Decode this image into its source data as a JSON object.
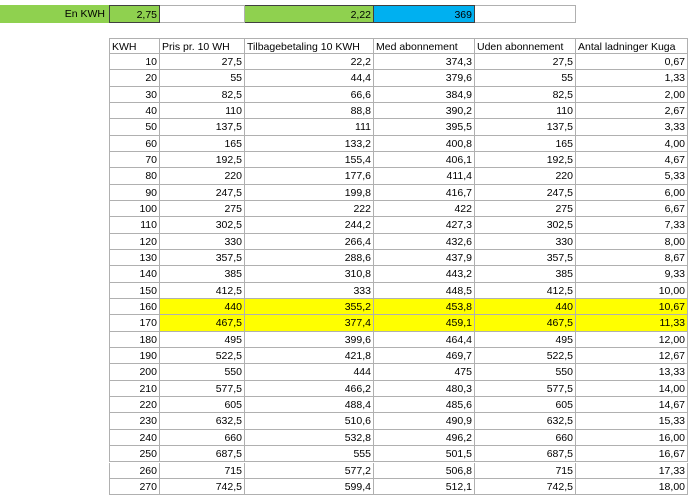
{
  "summary": {
    "label": "En KWH",
    "price": "2,75",
    "refund": "2,22",
    "subscription": "369"
  },
  "columns": [
    "KWH",
    "Pris pr. 10 WH",
    "Tilbagebetaling 10 KWH",
    "Med abonnement",
    "Uden abonnement",
    "Antal ladninger Kuga"
  ],
  "rows": [
    [
      "10",
      "27,5",
      "22,2",
      "374,3",
      "27,5",
      "0,67"
    ],
    [
      "20",
      "55",
      "44,4",
      "379,6",
      "55",
      "1,33"
    ],
    [
      "30",
      "82,5",
      "66,6",
      "384,9",
      "82,5",
      "2,00"
    ],
    [
      "40",
      "110",
      "88,8",
      "390,2",
      "110",
      "2,67"
    ],
    [
      "50",
      "137,5",
      "111",
      "395,5",
      "137,5",
      "3,33"
    ],
    [
      "60",
      "165",
      "133,2",
      "400,8",
      "165",
      "4,00"
    ],
    [
      "70",
      "192,5",
      "155,4",
      "406,1",
      "192,5",
      "4,67"
    ],
    [
      "80",
      "220",
      "177,6",
      "411,4",
      "220",
      "5,33"
    ],
    [
      "90",
      "247,5",
      "199,8",
      "416,7",
      "247,5",
      "6,00"
    ],
    [
      "100",
      "275",
      "222",
      "422",
      "275",
      "6,67"
    ],
    [
      "110",
      "302,5",
      "244,2",
      "427,3",
      "302,5",
      "7,33"
    ],
    [
      "120",
      "330",
      "266,4",
      "432,6",
      "330",
      "8,00"
    ],
    [
      "130",
      "357,5",
      "288,6",
      "437,9",
      "357,5",
      "8,67"
    ],
    [
      "140",
      "385",
      "310,8",
      "443,2",
      "385",
      "9,33"
    ],
    [
      "150",
      "412,5",
      "333",
      "448,5",
      "412,5",
      "10,00"
    ],
    [
      "160",
      "440",
      "355,2",
      "453,8",
      "440",
      "10,67"
    ],
    [
      "170",
      "467,5",
      "377,4",
      "459,1",
      "467,5",
      "11,33"
    ],
    [
      "180",
      "495",
      "399,6",
      "464,4",
      "495",
      "12,00"
    ],
    [
      "190",
      "522,5",
      "421,8",
      "469,7",
      "522,5",
      "12,67"
    ],
    [
      "200",
      "550",
      "444",
      "475",
      "550",
      "13,33"
    ],
    [
      "210",
      "577,5",
      "466,2",
      "480,3",
      "577,5",
      "14,00"
    ],
    [
      "220",
      "605",
      "488,4",
      "485,6",
      "605",
      "14,67"
    ],
    [
      "230",
      "632,5",
      "510,6",
      "490,9",
      "632,5",
      "15,33"
    ],
    [
      "240",
      "660",
      "532,8",
      "496,2",
      "660",
      "16,00"
    ],
    [
      "250",
      "687,5",
      "555",
      "501,5",
      "687,5",
      "16,67"
    ],
    [
      "260",
      "715",
      "577,2",
      "506,8",
      "715",
      "17,33"
    ],
    [
      "270",
      "742,5",
      "599,4",
      "512,1",
      "742,5",
      "18,00"
    ]
  ],
  "highlighted_rows": [
    15,
    16
  ],
  "colors": {
    "green": "#8fd14f",
    "blue": "#00b0f0",
    "yellow": "#ffff00"
  }
}
